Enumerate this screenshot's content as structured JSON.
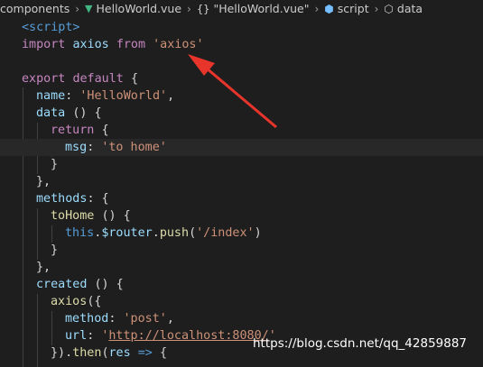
{
  "breadcrumb": {
    "folder": "components",
    "file": "HelloWorld.vue",
    "component": "\"HelloWorld.vue\"",
    "section": "script",
    "symbol": "data",
    "separator": "›",
    "icons": [
      "vue-icon",
      "braces-icon",
      "cube-icon",
      "data-icon"
    ]
  },
  "code": {
    "l1": {
      "t1": "<script>"
    },
    "l2": {
      "t1": "import",
      "t2": "axios",
      "t3": "from",
      "t4": "'axios'"
    },
    "l4": {
      "t1": "export",
      "t2": "default",
      "t3": "{"
    },
    "l5": {
      "t1": "name",
      "t2": ":",
      "t3": "'HelloWorld'",
      "t4": ","
    },
    "l6": {
      "t1": "data",
      "t2": "() {"
    },
    "l7": {
      "t1": "return",
      "t2": "{"
    },
    "l8": {
      "t1": "msg",
      "t2": ":",
      "t3": "'to home'"
    },
    "l9": {
      "t1": "}"
    },
    "l10": {
      "t1": "},"
    },
    "l11": {
      "t1": "methods",
      "t2": ": {"
    },
    "l12": {
      "t1": "toHome",
      "t2": "() {"
    },
    "l13": {
      "t1": "this",
      "t2": ".",
      "t3": "$router",
      "t4": ".",
      "t5": "push",
      "t6": "(",
      "t7": "'/index'",
      "t8": ")"
    },
    "l14": {
      "t1": "}"
    },
    "l15": {
      "t1": "},"
    },
    "l16": {
      "t1": "created",
      "t2": "() {"
    },
    "l17": {
      "t1": "axios",
      "t2": "({"
    },
    "l18": {
      "t1": "method",
      "t2": ":",
      "t3": "'post'",
      "t4": ","
    },
    "l19": {
      "t1": "url",
      "t2": ":",
      "t3": "'",
      "t4": "http://localhost:8080/",
      "t5": "'"
    },
    "l20": {
      "t1": "}).",
      "t2": "then",
      "t3": "(",
      "t4": "res",
      "t5": "=>",
      "t6": "{"
    }
  },
  "watermark": "https://blog.csdn.net/qq_42859887",
  "colors": {
    "background": "#1e1e1e",
    "keyword": "#c586c0",
    "storage": "#569cd6",
    "variable": "#9cdcfe",
    "string": "#ce9178",
    "function": "#dcdcaa",
    "arrow": "#e8352c"
  }
}
